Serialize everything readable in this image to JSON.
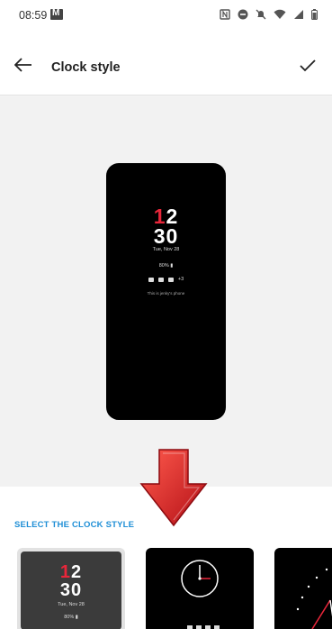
{
  "status": {
    "time": "08:59"
  },
  "appbar": {
    "title": "Clock style"
  },
  "preview": {
    "hour_prefix": "1",
    "hour_rest": "2",
    "minute": "30",
    "date": "Tue, Nov 28",
    "battery": "80% ▮",
    "notif_more": "+3",
    "message": "This is jenky's phone"
  },
  "section": {
    "label": "SELECT THE CLOCK STYLE"
  },
  "thumbs": {
    "t1": {
      "hour_prefix": "1",
      "hour_rest": "2",
      "minute": "30",
      "date": "Tue, Nov 28",
      "battery": "80% ▮"
    }
  },
  "colors": {
    "accent": "#1f8fd6",
    "clock_red": "#e8263a",
    "arrow_red": "#d81820"
  }
}
